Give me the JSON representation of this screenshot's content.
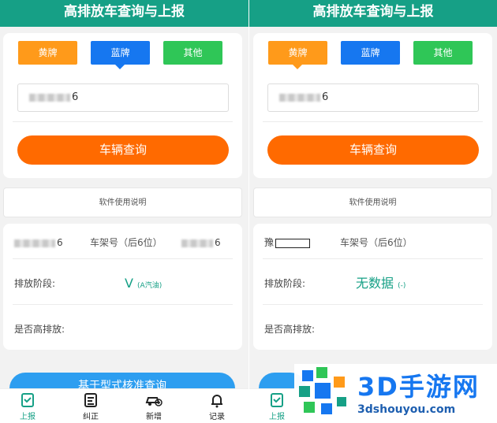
{
  "screens": [
    {
      "header": {
        "title": "高排放车查询与上报"
      },
      "plate_types": {
        "yellow": "黄牌",
        "blue": "蓝牌",
        "other": "其他"
      },
      "plate_input": {
        "value_suffix": "6"
      },
      "query_button": "车辆查询",
      "manual_link": "软件使用说明",
      "result": {
        "plate_suffix": "6",
        "vin_label": "车架号（后6位）",
        "vin_suffix": "6",
        "stage_label": "排放阶段:",
        "stage_value": "V",
        "stage_note": "(A汽油)",
        "high_emission_label": "是否高排放:"
      },
      "bottom_button": "基于型式核准查询",
      "nav": [
        "上报",
        "纠正",
        "新增",
        "记录"
      ]
    },
    {
      "header": {
        "title": "高排放车查询与上报"
      },
      "plate_types": {
        "yellow": "黄牌",
        "blue": "蓝牌",
        "other": "其他"
      },
      "plate_input": {
        "value_suffix": "6"
      },
      "query_button": "车辆查询",
      "manual_link": "软件使用说明",
      "result": {
        "plate_prefix": "豫",
        "vin_label": "车架号（后6位）",
        "stage_label": "排放阶段:",
        "stage_value": "无数据",
        "stage_note": "(-)",
        "high_emission_label": "是否高排放:"
      },
      "nav": [
        "上报"
      ]
    }
  ],
  "watermark": {
    "brand": "3D手游网",
    "url": "3dshouyou.com"
  },
  "colors": {
    "header": "#16a086",
    "yellow": "#ff9a1a",
    "blue": "#1677f0",
    "green": "#2fc657",
    "orange": "#ff6a00"
  }
}
